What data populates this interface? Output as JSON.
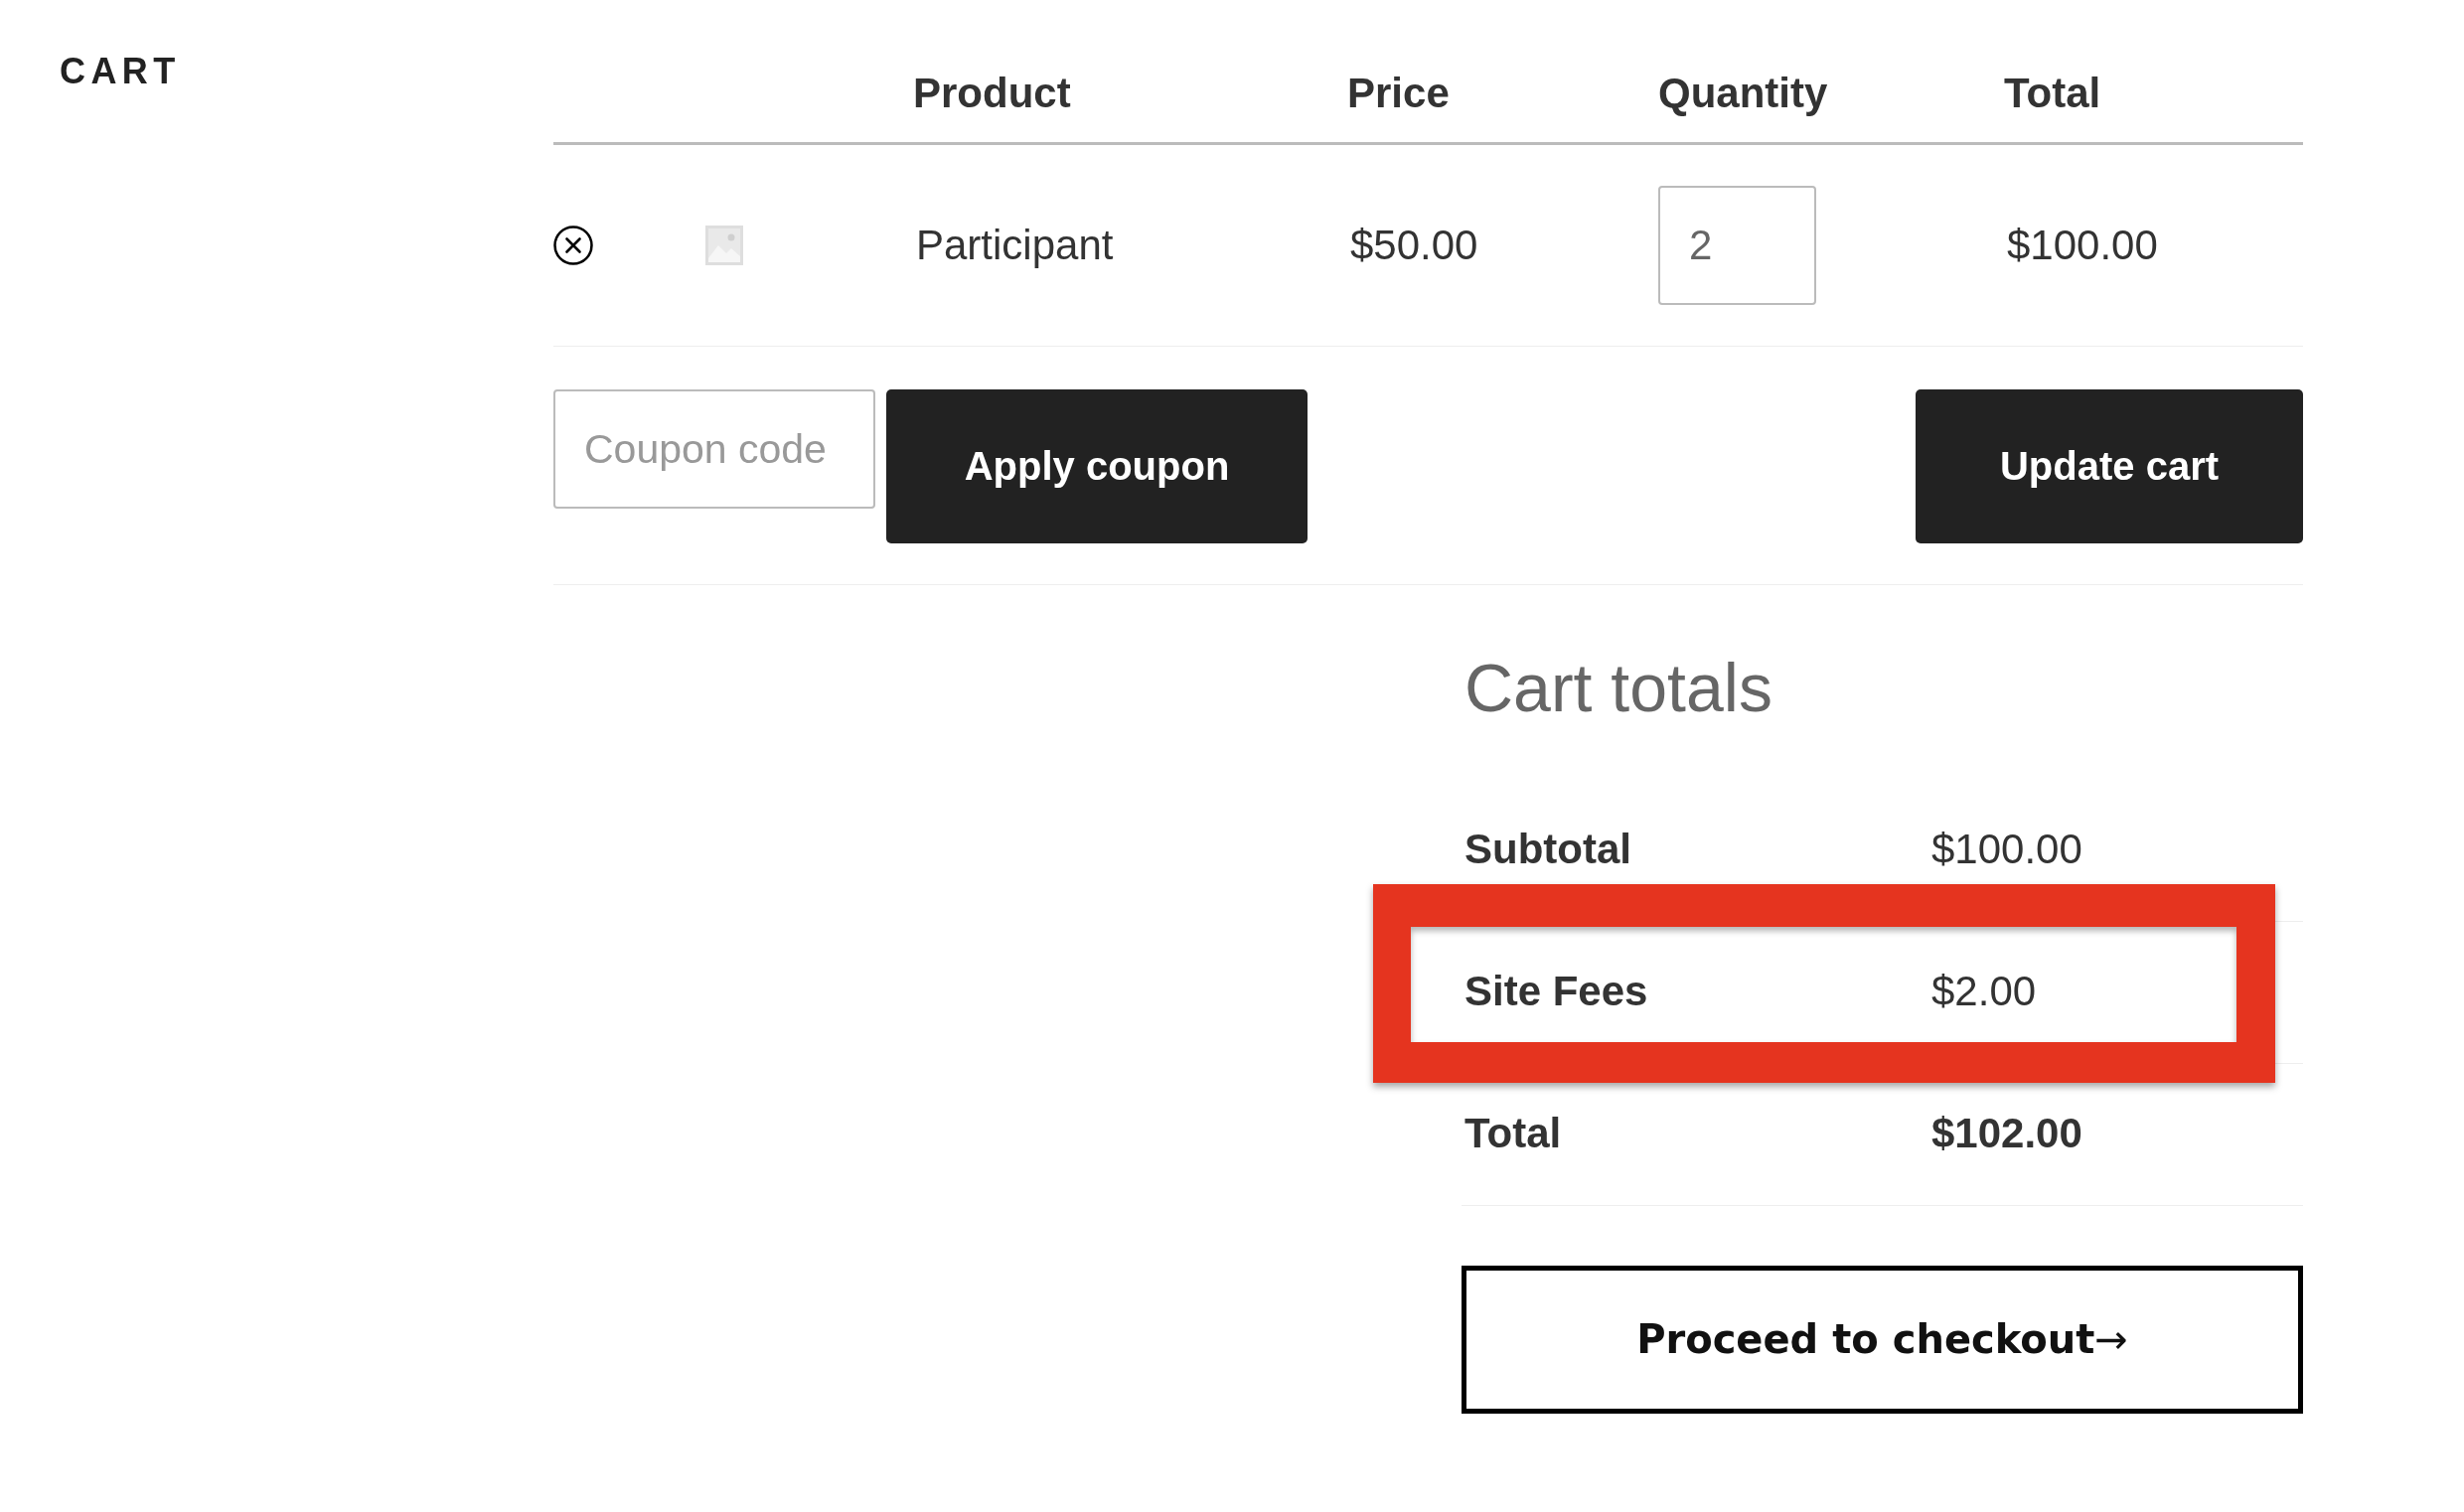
{
  "page_title": "CART",
  "cart_table": {
    "columns": [
      "Product",
      "Price",
      "Quantity",
      "Total"
    ],
    "rows": [
      {
        "product": "Participant",
        "price": "$50.00",
        "quantity": "2",
        "total": "$100.00"
      }
    ]
  },
  "coupon": {
    "placeholder": "Coupon code",
    "button": "Apply coupon"
  },
  "update_button": "Update cart",
  "cart_totals": {
    "title": "Cart totals",
    "rows": [
      {
        "kind": "line",
        "label": "Subtotal",
        "value": "$100.00",
        "highlighted": false
      },
      {
        "kind": "line",
        "label": "Site Fees",
        "value": "$2.00",
        "highlighted": true
      },
      {
        "kind": "grand_total",
        "label": "Total",
        "value": "$102.00",
        "highlighted": false
      }
    ]
  },
  "checkout_button": "**Proceed to checkout**→"
}
